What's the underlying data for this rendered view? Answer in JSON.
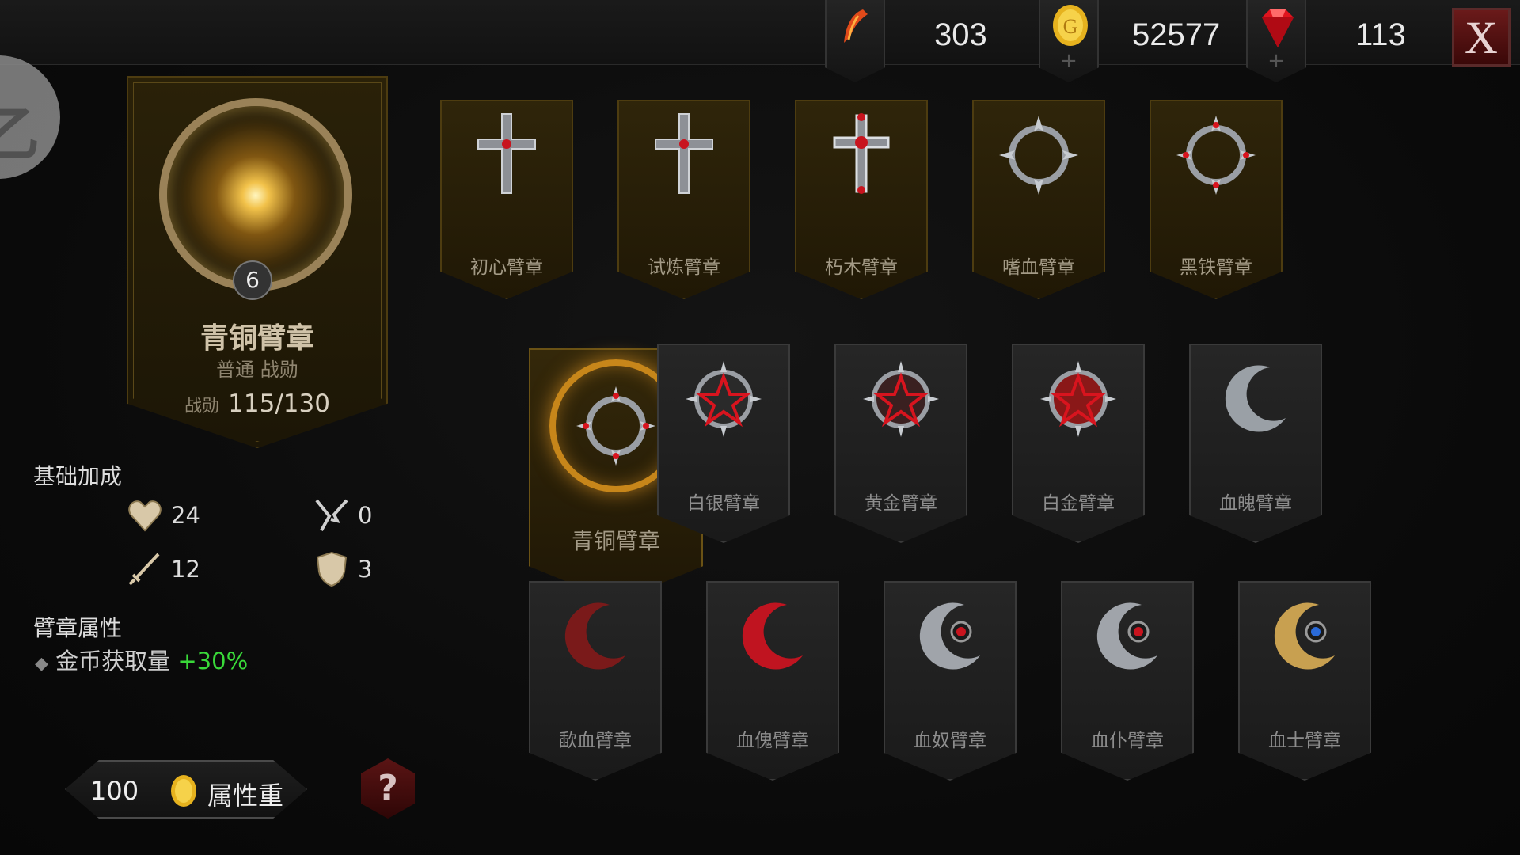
{
  "resources": {
    "energy": {
      "value": "303",
      "icon": "feather-icon"
    },
    "gold": {
      "value": "52577",
      "icon": "coin-icon"
    },
    "gems": {
      "value": "113",
      "icon": "ruby-icon"
    },
    "plus": "+"
  },
  "close_label": "X",
  "back_label": "乙",
  "selected": {
    "level": "6",
    "name": "青铜臂章",
    "type": "普通 战勋",
    "progress_label": "战勋",
    "progress": "115/130"
  },
  "base_bonus": {
    "title": "基础加成",
    "stats": [
      {
        "icon": "heart-icon",
        "value": "24"
      },
      {
        "icon": "crit-icon",
        "value": "0"
      },
      {
        "icon": "sword-icon",
        "value": "12"
      },
      {
        "icon": "shield-icon",
        "value": "3"
      }
    ]
  },
  "armband_attr": {
    "title": "臂章属性",
    "bullet": "◆",
    "name": "金币获取量",
    "bonus": "+30%"
  },
  "reforge": {
    "cost": "100",
    "label": "属性重铸"
  },
  "help_label": "?",
  "armbands": {
    "row1": [
      "初心臂章",
      "试炼臂章",
      "朽木臂章",
      "嗜血臂章",
      "黑铁臂章"
    ],
    "row2": [
      "青铜臂章",
      "白银臂章",
      "黄金臂章",
      "白金臂章",
      "血魄臂章"
    ],
    "row3": [
      "歃血臂章",
      "血傀臂章",
      "血奴臂章",
      "血仆臂章",
      "血士臂章"
    ]
  },
  "colors": {
    "accent_gold": "#c7861a",
    "bonus_green": "#39d939",
    "close_red": "#6a1a1a"
  }
}
